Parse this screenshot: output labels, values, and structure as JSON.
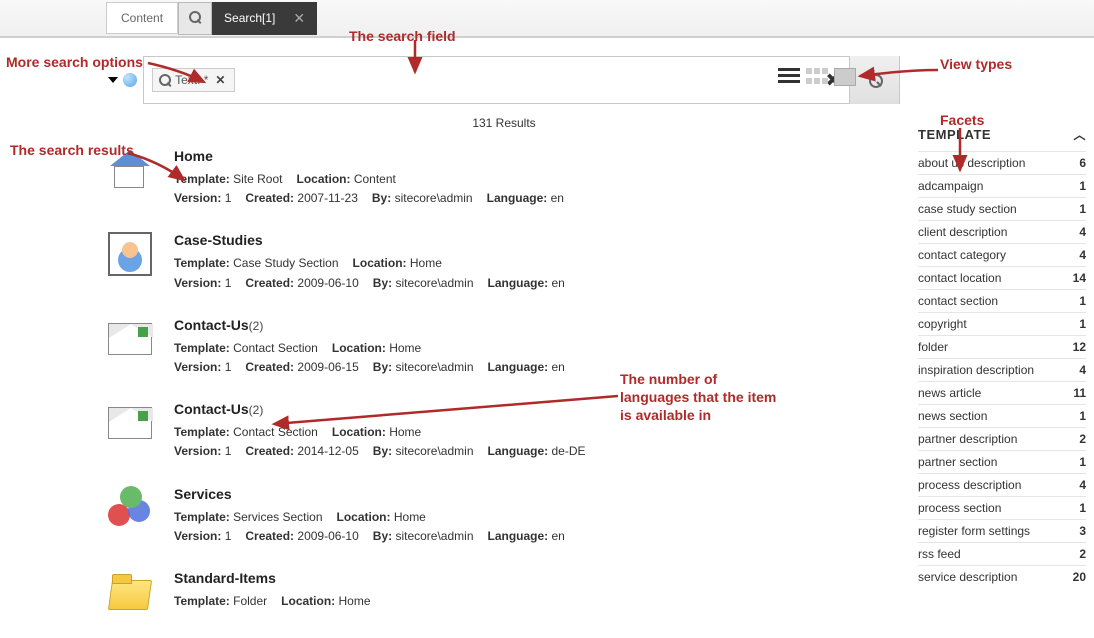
{
  "topbar": {
    "content_tab": "Content",
    "search_tab": "Search[1]"
  },
  "search": {
    "chip_text": "Text:  *",
    "input_value": ""
  },
  "results_count": "131 Results",
  "annotations": {
    "more_options": "More search options",
    "search_field": "The search field",
    "search_results": "The search results",
    "view_types": "View types",
    "facets": "Facets",
    "lang_count": "The number of languages that the item is available in"
  },
  "results": [
    {
      "icon": "home",
      "title": "Home",
      "lang_count": "",
      "template": "Site Root",
      "location": "Content",
      "version": "1",
      "created": "2007-11-23",
      "by": "sitecore\\admin",
      "language": "en"
    },
    {
      "icon": "person",
      "title": "Case-Studies",
      "lang_count": "",
      "template": "Case Study Section",
      "location": "Home",
      "version": "1",
      "created": "2009-06-10",
      "by": "sitecore\\admin",
      "language": "en"
    },
    {
      "icon": "mail",
      "title": "Contact-Us",
      "lang_count": "(2)",
      "template": "Contact Section",
      "location": "Home",
      "version": "1",
      "created": "2009-06-15",
      "by": "sitecore\\admin",
      "language": "en"
    },
    {
      "icon": "mail",
      "title": "Contact-Us",
      "lang_count": "(2)",
      "template": "Contact Section",
      "location": "Home",
      "version": "1",
      "created": "2014-12-05",
      "by": "sitecore\\admin",
      "language": "de-DE"
    },
    {
      "icon": "circles",
      "title": "Services",
      "lang_count": "",
      "template": "Services Section",
      "location": "Home",
      "version": "1",
      "created": "2009-06-10",
      "by": "sitecore\\admin",
      "language": "en"
    },
    {
      "icon": "folder",
      "title": "Standard-Items",
      "lang_count": "",
      "template": "Folder",
      "location": "Home"
    }
  ],
  "facets": {
    "title": "TEMPLATE",
    "items": [
      {
        "label": "about us description",
        "count": 6
      },
      {
        "label": "adcampaign",
        "count": 1
      },
      {
        "label": "case study section",
        "count": 1
      },
      {
        "label": "client description",
        "count": 4
      },
      {
        "label": "contact category",
        "count": 4
      },
      {
        "label": "contact location",
        "count": 14
      },
      {
        "label": "contact section",
        "count": 1
      },
      {
        "label": "copyright",
        "count": 1
      },
      {
        "label": "folder",
        "count": 12
      },
      {
        "label": "inspiration description",
        "count": 4
      },
      {
        "label": "news article",
        "count": 11
      },
      {
        "label": "news section",
        "count": 1
      },
      {
        "label": "partner description",
        "count": 2
      },
      {
        "label": "partner section",
        "count": 1
      },
      {
        "label": "process description",
        "count": 4
      },
      {
        "label": "process section",
        "count": 1
      },
      {
        "label": "register form settings",
        "count": 3
      },
      {
        "label": "rss feed",
        "count": 2
      },
      {
        "label": "service description",
        "count": 20
      }
    ]
  },
  "labels": {
    "template": "Template:",
    "location": "Location:",
    "version": "Version:",
    "created": "Created:",
    "by": "By:",
    "language": "Language:"
  }
}
